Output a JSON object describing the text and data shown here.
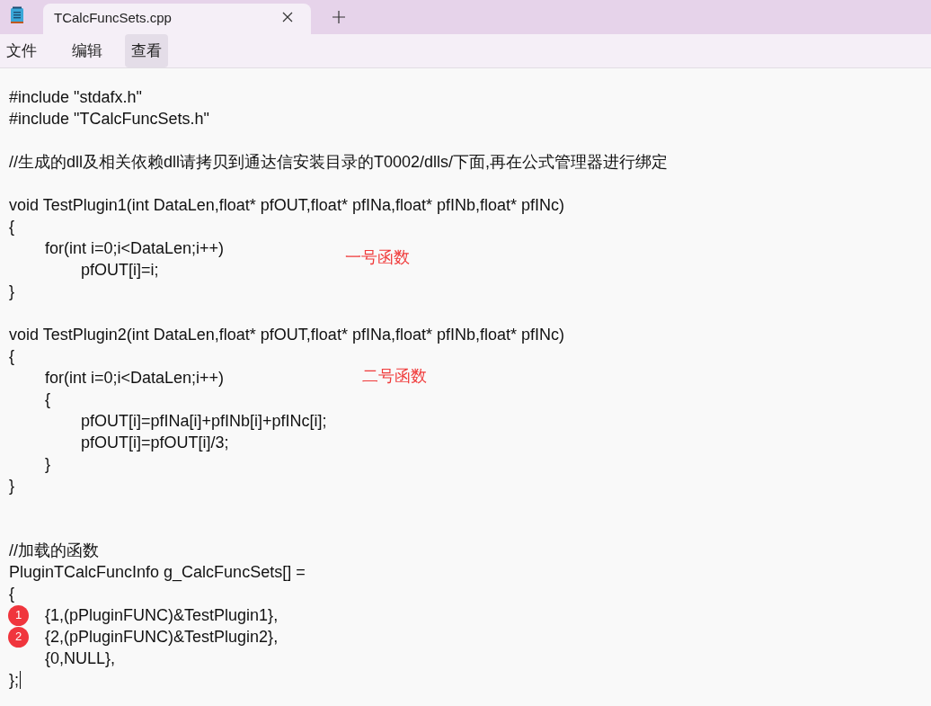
{
  "tabs": [
    {
      "label": "TCalcFuncSets.cpp",
      "selected": true
    }
  ],
  "menu": [
    {
      "label": "文件",
      "selected": false
    },
    {
      "label": "编辑",
      "selected": false
    },
    {
      "label": "查看",
      "selected": true
    }
  ],
  "lines": [
    {
      "kind": "code",
      "text": "#include \"stdafx.h\""
    },
    {
      "kind": "code",
      "text": "#include \"TCalcFuncSets.h\""
    },
    {
      "kind": "blank"
    },
    {
      "kind": "code",
      "text": "//生成的dll及相关依赖dll请拷贝到通达信安装目录的T0002/dlls/下面,再在公式管理器进行绑定"
    },
    {
      "kind": "blank"
    },
    {
      "kind": "code",
      "text": "void TestPlugin1(int DataLen,float* pfOUT,float* pfINa,float* pfINb,float* pfINc)"
    },
    {
      "kind": "code",
      "text": "{"
    },
    {
      "kind": "code",
      "text": "\tfor(int i=0;i<DataLen;i++)",
      "note": "一号函数"
    },
    {
      "kind": "code",
      "text": "\t\tpfOUT[i]=i;"
    },
    {
      "kind": "code",
      "text": "}"
    },
    {
      "kind": "blank"
    },
    {
      "kind": "code",
      "text": "void TestPlugin2(int DataLen,float* pfOUT,float* pfINa,float* pfINb,float* pfINc)"
    },
    {
      "kind": "code",
      "text": "{"
    },
    {
      "kind": "code",
      "text": "\tfor(int i=0;i<DataLen;i++)",
      "note": "二号函数"
    },
    {
      "kind": "code",
      "text": "\t{"
    },
    {
      "kind": "code",
      "text": "\t\tpfOUT[i]=pfINa[i]+pfINb[i]+pfINc[i];"
    },
    {
      "kind": "code",
      "text": "\t\tpfOUT[i]=pfOUT[i]/3;"
    },
    {
      "kind": "code",
      "text": "\t}"
    },
    {
      "kind": "code",
      "text": "}"
    },
    {
      "kind": "blank"
    },
    {
      "kind": "blank"
    },
    {
      "kind": "code",
      "text": "//加载的函数"
    },
    {
      "kind": "code",
      "text": "PluginTCalcFuncInfo g_CalcFuncSets[] ="
    },
    {
      "kind": "code",
      "text": "{"
    },
    {
      "kind": "code",
      "text": "{1,(pPluginFUNC)&TestPlugin1},",
      "badge": "1"
    },
    {
      "kind": "code",
      "text": "{2,(pPluginFUNC)&TestPlugin2},",
      "badge": "2"
    },
    {
      "kind": "code",
      "text": "\t{0,NULL},"
    },
    {
      "kind": "code",
      "text": "};",
      "cursor": true
    }
  ]
}
